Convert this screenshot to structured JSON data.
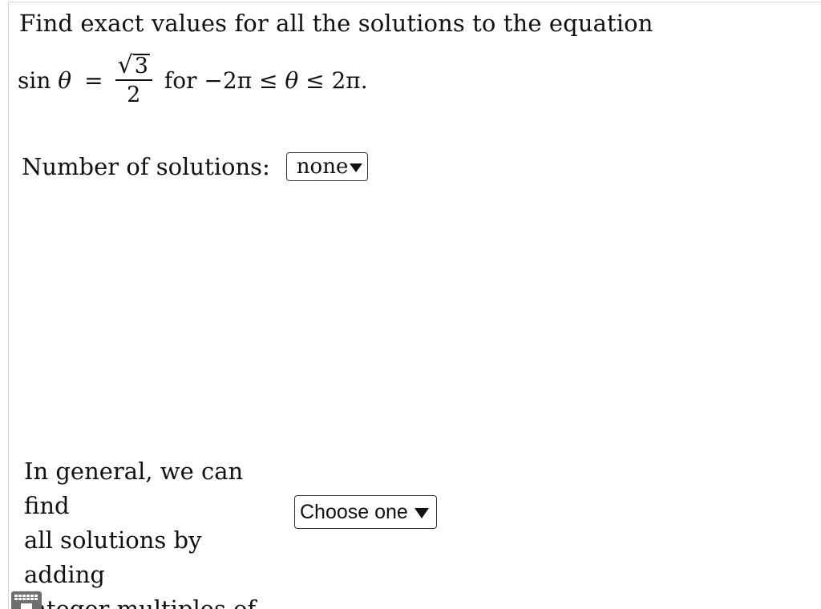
{
  "question": {
    "prompt": "Find exact values for all the solutions to the equation",
    "equation": {
      "lhs_fn": "sin",
      "lhs_var": "θ",
      "equals": "=",
      "numerator_radical": "√",
      "numerator_radicand": "3",
      "denominator": "2",
      "connector": "for",
      "range_prefix": "−2π ≤ ",
      "range_var": "θ",
      "range_suffix": " ≤ 2π."
    }
  },
  "solutions_count": {
    "label": "Number of solutions:",
    "selected": "none"
  },
  "general_solution": {
    "line1": "In general, we can find",
    "line2": "all solutions by adding",
    "line3": "integer multiples of",
    "selected": "Choose one"
  },
  "icons": {
    "dropdown": "triangle-down-icon",
    "keyboard": "keyboard-icon"
  }
}
